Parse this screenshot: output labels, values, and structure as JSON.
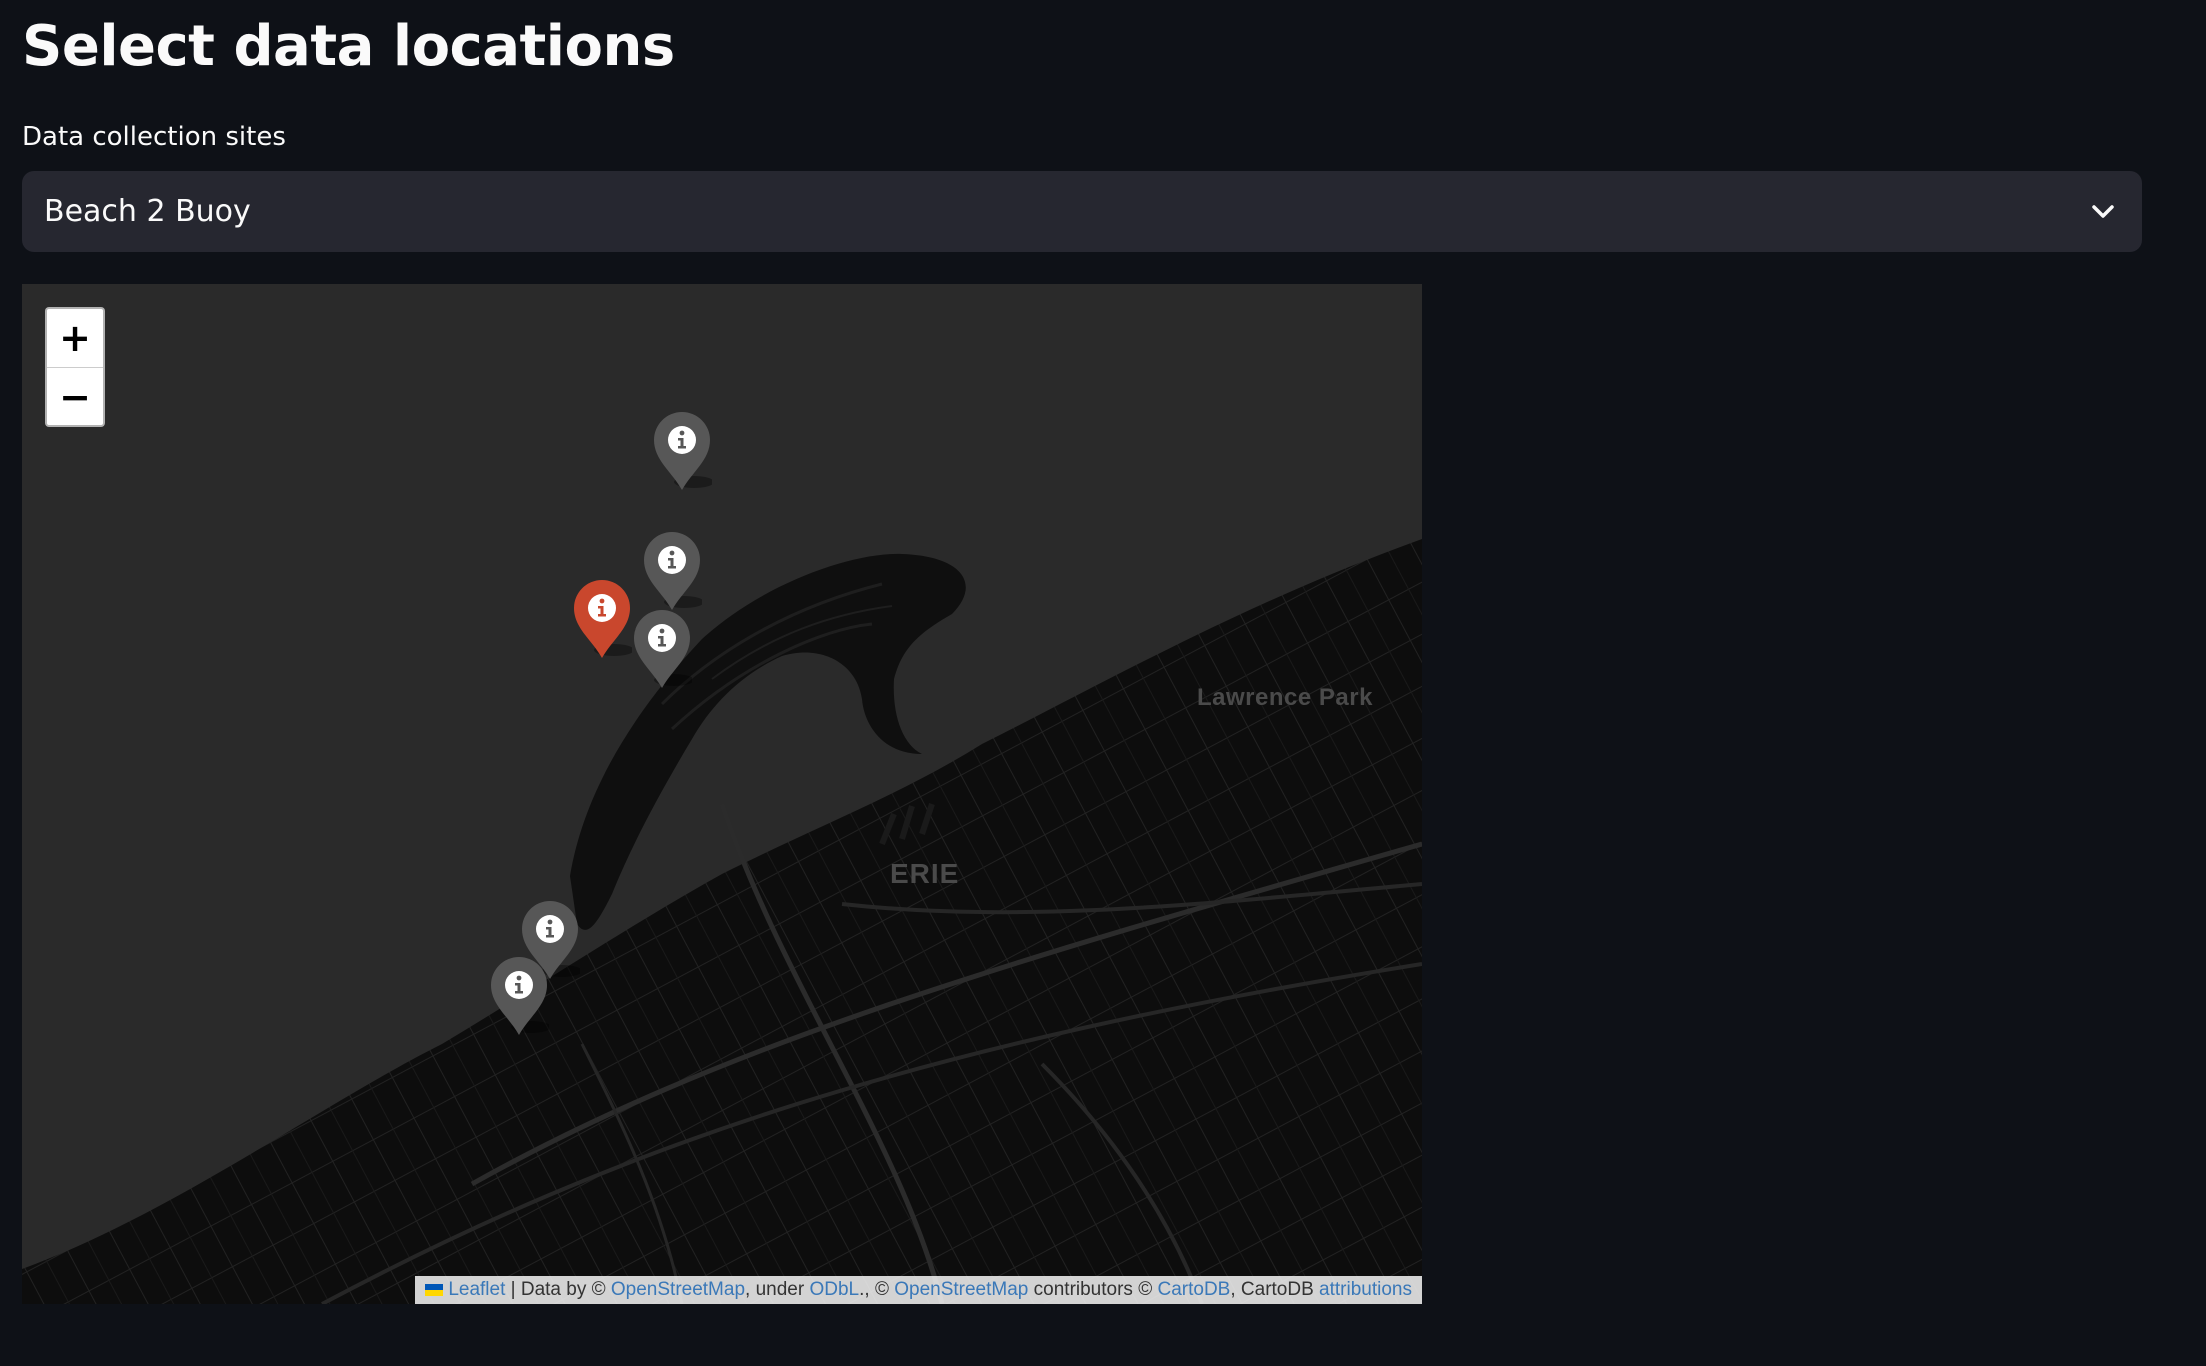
{
  "page": {
    "title": "Select data locations"
  },
  "sites_select": {
    "label": "Data collection sites",
    "selected": "Beach 2 Buoy"
  },
  "map": {
    "zoom_in": "+",
    "zoom_out": "−",
    "place_labels": {
      "city": "ERIE",
      "town": "Lawrence Park"
    },
    "markers": [
      {
        "color": "#575757",
        "icon": "info-icon",
        "selected": false
      },
      {
        "color": "#575757",
        "icon": "info-icon",
        "selected": false
      },
      {
        "color": "#c9472d",
        "icon": "info-icon",
        "selected": true
      },
      {
        "color": "#575757",
        "icon": "info-icon",
        "selected": false
      },
      {
        "color": "#575757",
        "icon": "info-icon",
        "selected": false
      },
      {
        "color": "#575757",
        "icon": "info-icon",
        "selected": false
      }
    ],
    "attribution": {
      "leaflet": "Leaflet",
      "sep1": " | Data by © ",
      "osm1": "OpenStreetMap",
      "under": ", under ",
      "odbl": "ODbL",
      "sep2": "., © ",
      "osm2": "OpenStreetMap",
      "contributors": " contributors © ",
      "cartodb": "CartoDB",
      "cartodb_text": ", CartoDB ",
      "attributions": "attributions"
    }
  }
}
